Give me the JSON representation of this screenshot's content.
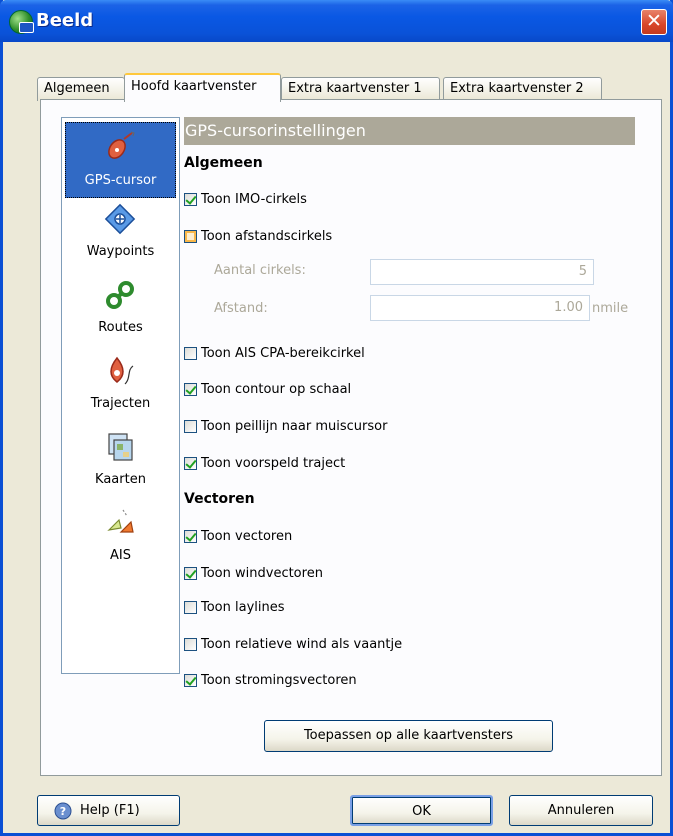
{
  "window": {
    "title": "Beeld",
    "close_symbol": "✕"
  },
  "tabs": [
    {
      "label": "Algemeen"
    },
    {
      "label": "Hoofd kaartvenster"
    },
    {
      "label": "Extra kaartvenster 1"
    },
    {
      "label": "Extra kaartvenster 2"
    }
  ],
  "nav": [
    {
      "label": "GPS-cursor",
      "icon": "gps-cursor-icon"
    },
    {
      "label": "Waypoints",
      "icon": "waypoint-icon"
    },
    {
      "label": "Routes",
      "icon": "routes-icon"
    },
    {
      "label": "Trajecten",
      "icon": "track-icon"
    },
    {
      "label": "Kaarten",
      "icon": "charts-icon"
    },
    {
      "label": "AIS",
      "icon": "ais-icon"
    }
  ],
  "section": {
    "title": "GPS-cursorinstellingen"
  },
  "general": {
    "title": "Algemeen",
    "imo": {
      "label": "Toon IMO-cirkels",
      "checked": true
    },
    "range_rings": {
      "label": "Toon afstandscirkels",
      "checked": false
    },
    "ring_count": {
      "label": "Aantal cirkels:",
      "value": "5"
    },
    "ring_distance": {
      "label": "Afstand:",
      "value": "1.00",
      "unit": "nmile"
    },
    "ais_cpa": {
      "label": "Toon AIS CPA-bereikcirkel",
      "checked": false
    },
    "contour": {
      "label": "Toon contour op schaal",
      "checked": true
    },
    "bearing": {
      "label": "Toon peillijn naar muiscursor",
      "checked": false
    },
    "predicted": {
      "label": "Toon voorspeld traject",
      "checked": true
    }
  },
  "vectors": {
    "title": "Vectoren",
    "vectors": {
      "label": "Toon vectoren",
      "checked": true
    },
    "wind": {
      "label": "Toon windvectoren",
      "checked": true
    },
    "laylines": {
      "label": "Toon laylines",
      "checked": false
    },
    "rel_wind": {
      "label": "Toon relatieve wind als vaantje",
      "checked": false
    },
    "current": {
      "label": "Toon stromingsvectoren",
      "checked": true
    }
  },
  "apply_all_label": "Toepassen op alle kaartvensters",
  "buttons": {
    "help": "Help (F1)",
    "ok": "OK",
    "cancel": "Annuleren"
  }
}
